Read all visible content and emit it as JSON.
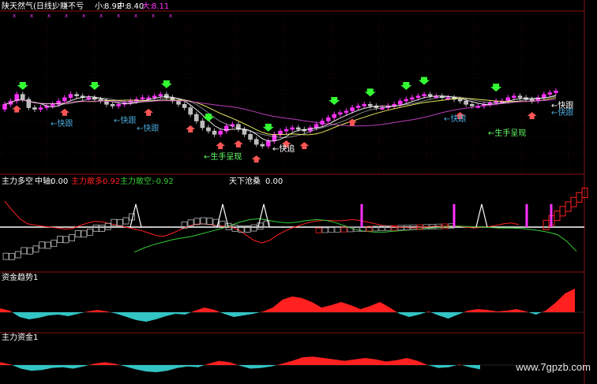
{
  "top_header": {
    "title": "陕天然气(日线)",
    "status": "少赚不亏",
    "small_label": "小:",
    "small_value": "8.92",
    "mid_label": "中:",
    "mid_value": "8.40",
    "big_label": "大:",
    "big_value": "8.11"
  },
  "annotations": {
    "fast_follow": "←快跟",
    "fast_chase": "←快追",
    "new_hand": "←生手呈现"
  },
  "panel2": {
    "label": "主力多空",
    "mid_label": "中轴:",
    "mid_value": "0.00",
    "bull_label": "主力敢多:",
    "bull_value": "0.92",
    "bear_label": "主力敢空:",
    "bear_value": "-0.92",
    "extra_label": "天下沧桑",
    "extra_value": "0.00"
  },
  "panel3": {
    "label": "资金趋势1"
  },
  "panel4": {
    "label": "主力资金1"
  },
  "watermark": "www.7gpzb.com",
  "colors": {
    "background": "#000000",
    "magenta": "#ff33ff",
    "white": "#ffffff",
    "red": "#ff2020",
    "green": "#33cc33",
    "cyan": "#33c4c4",
    "grid": "#8a1010",
    "yellow": "#ffff00",
    "label_green": "#66ff66",
    "label_blue": "#4aa8d8"
  },
  "chart_data": [
    {
      "type": "candlestick",
      "closes": [
        8.6,
        8.7,
        8.9,
        8.75,
        8.5,
        8.45,
        8.5,
        8.55,
        8.6,
        8.7,
        8.8,
        8.9,
        8.85,
        8.8,
        8.8,
        8.75,
        8.7,
        8.6,
        8.55,
        8.6,
        8.65,
        8.7,
        8.75,
        8.8,
        8.8,
        8.85,
        8.9,
        8.8,
        8.7,
        8.6,
        8.5,
        8.3,
        8.1,
        7.9,
        7.8,
        7.7,
        7.8,
        7.95,
        8.0,
        7.85,
        7.7,
        7.55,
        7.4,
        7.35,
        7.5,
        7.7,
        7.8,
        7.85,
        7.9,
        7.85,
        7.8,
        7.9,
        8.0,
        8.1,
        8.2,
        8.3,
        8.35,
        8.4,
        8.5,
        8.55,
        8.6,
        8.55,
        8.5,
        8.5,
        8.55,
        8.6,
        8.7,
        8.75,
        8.8,
        8.85,
        8.9,
        8.85,
        8.85,
        8.8,
        8.8,
        8.75,
        8.7,
        8.6,
        8.55,
        8.55,
        8.6,
        8.65,
        8.7,
        8.7,
        8.8,
        8.85,
        8.8,
        8.75,
        8.7,
        8.8,
        8.9,
        8.95,
        9.0
      ]
    },
    {
      "type": "line",
      "series": [
        {
          "name": "主力敢多",
          "values": [
            0.62,
            0.4,
            0.2,
            0.08,
            0.05,
            0.02,
            0.0,
            -0.02,
            -0.05,
            -0.03,
            0.04,
            0.1,
            0.14,
            0.12,
            0.08,
            0.04,
            0.0,
            -0.04,
            -0.08,
            -0.14,
            -0.2,
            -0.22,
            -0.16,
            -0.08,
            0.0,
            0.06,
            0.08,
            0.06,
            0.04,
            0.02,
            0.0,
            -0.08,
            -0.2,
            -0.32,
            -0.38,
            -0.32,
            -0.2,
            -0.1,
            -0.02,
            0.04,
            0.1,
            0.14,
            0.16,
            0.16,
            0.15,
            0.16,
            0.18,
            0.16,
            0.12,
            0.08,
            0.04,
            0.02,
            0.0,
            -0.01,
            -0.02,
            0.0,
            0.01,
            0.02,
            0.02,
            0.03,
            0.02,
            0.0,
            -0.02,
            -0.01,
            0.01,
            0.04,
            0.08,
            0.1,
            0.06
          ]
        },
        {
          "name": "主力敢空",
          "values": [
            -0.6,
            -0.5,
            -0.42,
            -0.36,
            -0.3,
            -0.26,
            -0.22,
            -0.16,
            -0.1,
            -0.04,
            0.04,
            0.12,
            0.18,
            0.2,
            0.16,
            0.12,
            0.1,
            0.12,
            0.16,
            0.18,
            0.16,
            0.1,
            0.02,
            -0.06,
            -0.1,
            -0.12,
            -0.12,
            -0.1,
            -0.08,
            -0.06,
            -0.04,
            -0.02,
            0.0,
            0.02,
            0.02,
            0.01,
            0.0,
            -0.01,
            -0.02,
            -0.02,
            -0.03,
            -0.05,
            -0.08,
            -0.12,
            -0.18,
            -0.34,
            -0.58
          ]
        }
      ],
      "ylim": [
        -1.0,
        1.0
      ]
    },
    {
      "type": "area",
      "name": "资金趋势1",
      "values": [
        0.5,
        0.2,
        -0.6,
        -0.9,
        -0.7,
        -0.4,
        -0.3,
        -0.5,
        -0.2,
        0.1,
        0.3,
        0.1,
        -0.2,
        -0.6,
        -1.0,
        -1.2,
        -0.9,
        -0.5,
        -0.2,
        -0.3,
        0.2,
        0.6,
        0.3,
        -0.2,
        -0.6,
        -0.4,
        -0.2,
        0.1,
        0.6,
        1.6,
        2.0,
        1.8,
        1.3,
        0.6,
        0.9,
        1.3,
        0.9,
        0.4,
        0.8,
        1.3,
        0.6,
        -0.2,
        -0.6,
        -0.3,
        0.1,
        -0.4,
        -0.8,
        -0.3,
        0.2,
        0.4,
        0.3,
        0.1,
        0.2,
        0.4,
        0.1,
        -0.3,
        0.2,
        1.2,
        2.4,
        3.0
      ]
    },
    {
      "type": "area",
      "name": "主力资金1",
      "values": [
        0.4,
        0.1,
        -0.5,
        -0.8,
        -0.7,
        -0.4,
        -0.3,
        -0.5,
        -0.2,
        0.2,
        0.4,
        0.2,
        -0.2,
        -0.6,
        -0.9,
        -1.0,
        -0.8,
        -0.4,
        -0.2,
        -0.3,
        0.2,
        0.6,
        0.4,
        -0.1,
        -0.5,
        -0.4,
        -0.2,
        0.2,
        0.6,
        1.1,
        1.2,
        1.0,
        0.8,
        0.6,
        0.8,
        1.0,
        0.8,
        0.5,
        0.7,
        1.0,
        0.6,
        0.0,
        -0.4,
        -0.3,
        0.1,
        -0.3,
        -0.6
      ]
    }
  ]
}
